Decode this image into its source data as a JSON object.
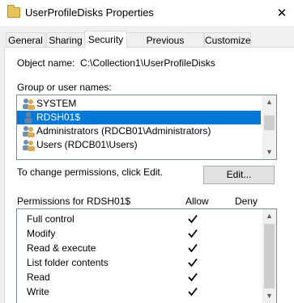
{
  "window": {
    "title": "UserProfileDisks Properties",
    "close_glyph": "✕"
  },
  "tabs": [
    {
      "label": "General"
    },
    {
      "label": "Sharing"
    },
    {
      "label": "Security"
    },
    {
      "label": "Previous Versions"
    },
    {
      "label": "Customize"
    }
  ],
  "security": {
    "object_name_label": "Object name:",
    "object_name_value": "C:\\Collection1\\UserProfileDisks",
    "groups_label": "Group or user names:",
    "groups": [
      {
        "name": "SYSTEM",
        "icon": "users-group-icon",
        "selected": false
      },
      {
        "name": "RDSH01$",
        "icon": "user-icon",
        "selected": true
      },
      {
        "name": "Administrators (RDCB01\\Administrators)",
        "icon": "users-group-icon",
        "selected": false
      },
      {
        "name": "Users (RDCB01\\Users)",
        "icon": "users-group-icon",
        "selected": false
      }
    ],
    "change_text": "To change permissions, click Edit.",
    "edit_label": "Edit...",
    "permissions_label": "Permissions for RDSH01$",
    "allow_header": "Allow",
    "deny_header": "Deny",
    "permissions": [
      {
        "name": "Full control",
        "allow": true,
        "deny": false
      },
      {
        "name": "Modify",
        "allow": true,
        "deny": false
      },
      {
        "name": "Read & execute",
        "allow": true,
        "deny": false
      },
      {
        "name": "List folder contents",
        "allow": true,
        "deny": false
      },
      {
        "name": "Read",
        "allow": true,
        "deny": false
      },
      {
        "name": "Write",
        "allow": true,
        "deny": false
      }
    ]
  }
}
